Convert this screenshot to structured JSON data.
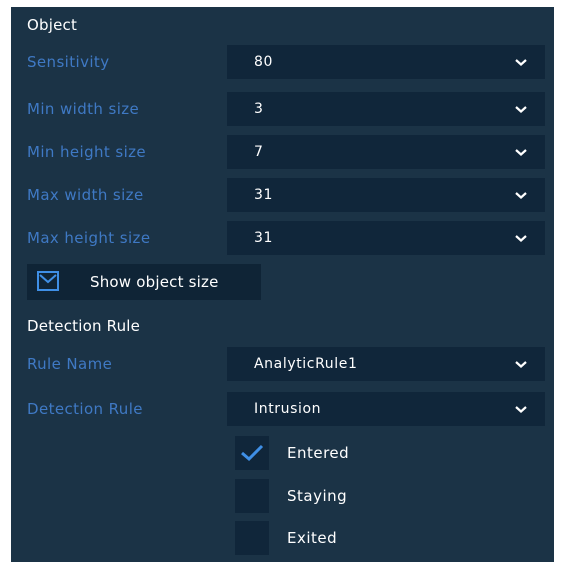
{
  "object_section": {
    "title": "Object",
    "fields": [
      {
        "label": "Sensitivity",
        "value": "80"
      },
      {
        "label": "Min width size",
        "value": "3"
      },
      {
        "label": "Min height size",
        "value": "7"
      },
      {
        "label": "Max width size",
        "value": "31"
      },
      {
        "label": "Max height size",
        "value": "31"
      }
    ],
    "show_object_size": {
      "label": "Show object size",
      "checked": true
    }
  },
  "rule_section": {
    "title": "Detection Rule",
    "fields": [
      {
        "label": "Rule Name",
        "value": "AnalyticRule1"
      },
      {
        "label": "Detection Rule",
        "value": "Intrusion"
      }
    ],
    "options": [
      {
        "label": "Entered",
        "checked": true
      },
      {
        "label": "Staying",
        "checked": false
      },
      {
        "label": "Exited",
        "checked": false
      }
    ]
  },
  "colors": {
    "panel_bg": "#1b3346",
    "field_bg": "#10263a",
    "label_blue": "#3f79c4",
    "check_blue": "#3f8fe6"
  },
  "icons": {
    "dropdown": "chevron-down-icon",
    "check": "checkmark-icon",
    "envelope": "envelope-icon"
  }
}
